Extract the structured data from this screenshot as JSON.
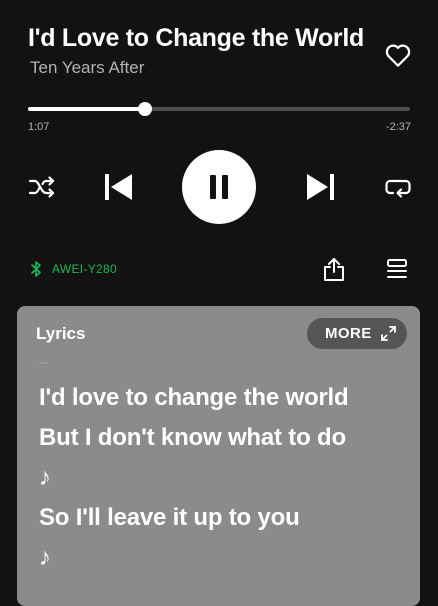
{
  "track": {
    "title": "I'd Love to Change the World",
    "artist": "Ten Years After",
    "liked": false
  },
  "playback": {
    "elapsed": "1:07",
    "remaining": "-2:37",
    "progress_fraction": 0.306,
    "state": "playing"
  },
  "icons": {
    "like": "heart-outline-icon",
    "shuffle": "shuffle-icon",
    "previous": "skip-previous-icon",
    "pause": "pause-icon",
    "next": "skip-next-icon",
    "repeat": "repeat-icon",
    "device": "bluetooth-icon",
    "share": "share-icon",
    "queue": "queue-icon",
    "expand": "expand-icon"
  },
  "device": {
    "name": "AWEI-Y280"
  },
  "lyrics": {
    "heading": "Lyrics",
    "more_label": "MORE",
    "separator": "–",
    "lines": [
      "I'd love to change the world",
      "But I don't know what to do",
      "♪",
      "So I'll leave it up to you",
      "♪"
    ]
  },
  "colors": {
    "background": "#121212",
    "accent_green": "#1db954",
    "lyrics_card": "#8b8b8b",
    "secondary_text": "#b3b3b3"
  }
}
